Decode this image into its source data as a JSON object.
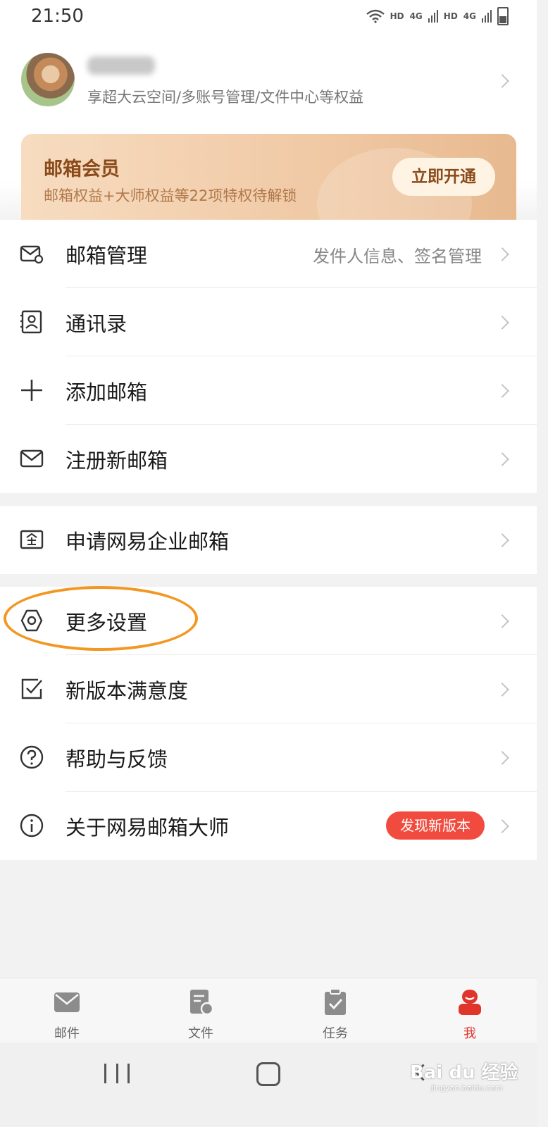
{
  "status_bar": {
    "time": "21:50",
    "network_labels": [
      "HD",
      "4G",
      "HD",
      "4G"
    ]
  },
  "profile": {
    "subtitle": "享超大云空间/多账号管理/文件中心等权益"
  },
  "vip_card": {
    "title": "邮箱会员",
    "subtitle": "邮箱权益+大师权益等22项特权待解锁",
    "button": "立即开通"
  },
  "menu_group_1": [
    {
      "label": "邮箱管理",
      "right_text": "发件人信息、签名管理",
      "icon": "mailbox-settings-icon"
    },
    {
      "label": "通讯录",
      "icon": "contacts-icon"
    },
    {
      "label": "添加邮箱",
      "icon": "plus-icon"
    },
    {
      "label": "注册新邮箱",
      "icon": "envelope-icon"
    }
  ],
  "menu_group_2": [
    {
      "label": "申请网易企业邮箱",
      "icon": "enterprise-icon"
    }
  ],
  "menu_group_3": [
    {
      "label": "更多设置",
      "icon": "settings-icon"
    },
    {
      "label": "新版本满意度",
      "icon": "checkbox-icon"
    },
    {
      "label": "帮助与反馈",
      "icon": "help-icon"
    },
    {
      "label": "关于网易邮箱大师",
      "badge": "发现新版本",
      "icon": "info-icon"
    }
  ],
  "tab_bar": [
    {
      "label": "邮件",
      "icon": "mail-tab-icon"
    },
    {
      "label": "文件",
      "icon": "file-tab-icon"
    },
    {
      "label": "任务",
      "icon": "task-tab-icon"
    },
    {
      "label": "我",
      "icon": "me-tab-icon",
      "active": true
    }
  ],
  "watermark": {
    "text": "Bai du 经验",
    "sub": "jingyan.baidu.com"
  },
  "colors": {
    "accent_red": "#e0352b",
    "highlight_orange": "#f29722",
    "vip_brown": "#8b4a1a"
  }
}
